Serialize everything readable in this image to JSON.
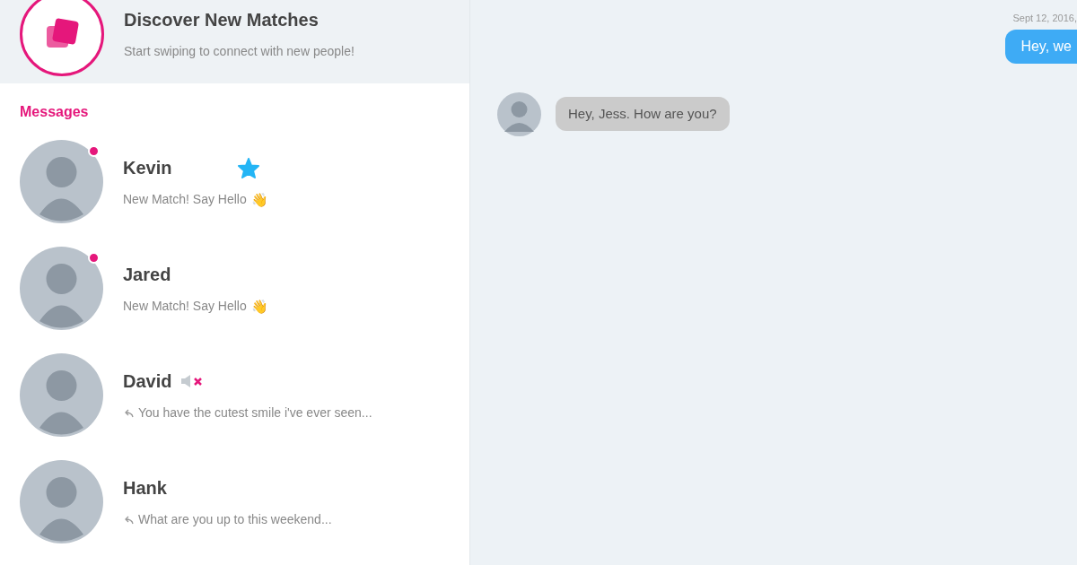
{
  "discover": {
    "title": "Discover New Matches",
    "subtitle": "Start swiping to connect with new people!"
  },
  "messages_heading": "Messages",
  "conversations": [
    {
      "name": "Kevin",
      "preview": "New Match! Say Hello",
      "emoji": "👋",
      "kind": "new_match",
      "unread": true,
      "starred": true,
      "muted": false
    },
    {
      "name": "Jared",
      "preview": "New Match! Say Hello",
      "emoji": "👋",
      "kind": "new_match",
      "unread": true,
      "starred": false,
      "muted": false
    },
    {
      "name": "David",
      "preview": "You have the cutest smile i've ever seen...",
      "kind": "reply",
      "unread": false,
      "starred": false,
      "muted": true
    },
    {
      "name": "Hank",
      "preview": "What are you up to this weekend...",
      "kind": "reply",
      "unread": false,
      "starred": false,
      "muted": false
    }
  ],
  "chat": {
    "timestamp": "Sept 12, 2016,",
    "messages": [
      {
        "kind": "sent",
        "text": "Hey, we"
      },
      {
        "kind": "received",
        "text": "Hey, Jess. How are you?"
      }
    ]
  }
}
